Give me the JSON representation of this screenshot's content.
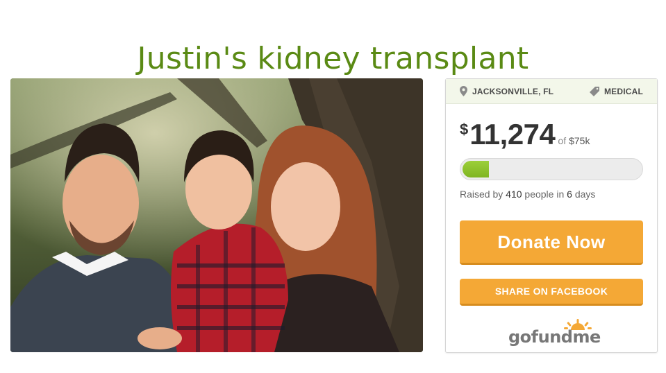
{
  "campaign": {
    "title": "Justin's kidney transplant",
    "location": "JACKSONVILLE, FL",
    "category": "MEDICAL",
    "currency_symbol": "$",
    "raised_amount": "11,274",
    "of_label": "of",
    "goal": "$75k",
    "progress_fraction": 0.15,
    "raised_prefix": "Raised by",
    "donor_count": "410",
    "people_in": "people in",
    "days_count": "6",
    "days_label": "days"
  },
  "buttons": {
    "donate_label": "Donate Now",
    "share_label": "SHARE ON FACEBOOK"
  },
  "logo": {
    "go": "go",
    "fund": "fund",
    "me": "me"
  },
  "icons": {
    "location": "map-pin-icon",
    "category": "tag-icon"
  },
  "colors": {
    "title_green": "#5a8a14",
    "button_orange": "#f4a836",
    "progress_green": "#7fb522",
    "logo_sun": "#f4a836"
  }
}
